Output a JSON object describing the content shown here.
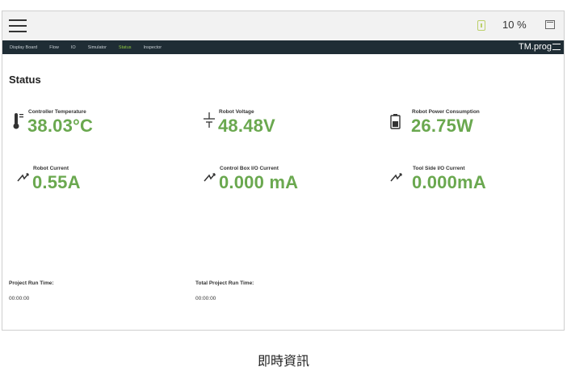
{
  "topbar": {
    "zoom_level": "10 %"
  },
  "nav": {
    "tabs": [
      {
        "label": "Display Board"
      },
      {
        "label": "Flow"
      },
      {
        "label": "IO"
      },
      {
        "label": "Simulator"
      },
      {
        "label": "Status"
      },
      {
        "label": "Inspector"
      }
    ],
    "active_tab": "Status",
    "brand": "TM.prog"
  },
  "page": {
    "title": "Status"
  },
  "metrics": [
    {
      "label": "Controller Temperature",
      "value": "38.03°C",
      "icon": "thermometer-icon"
    },
    {
      "label": "Robot Voltage",
      "value": "48.48V",
      "icon": "voltage-icon"
    },
    {
      "label": "Robot Power Consumption",
      "value": "26.75W",
      "icon": "battery-icon"
    },
    {
      "label": "Robot Current",
      "value": "0.55A",
      "icon": "lightning-icon"
    },
    {
      "label": "Control Box I/O Current",
      "value": "0.000 mA",
      "icon": "lightning-icon"
    },
    {
      "label": "Tool Side I/O Current",
      "value": "0.000mA",
      "icon": "lightning-icon"
    }
  ],
  "footer": {
    "project_run_time_label": "Project Run Time:",
    "project_run_time_value": "00:00:00",
    "total_project_run_time_label": "Total Project Run Time:",
    "total_project_run_time_value": "00:00:00"
  },
  "caption": "即時資訊",
  "colors": {
    "accent_green": "#6aa84f",
    "nav_background": "#1f2d35",
    "active_tab": "#8dc63f"
  }
}
